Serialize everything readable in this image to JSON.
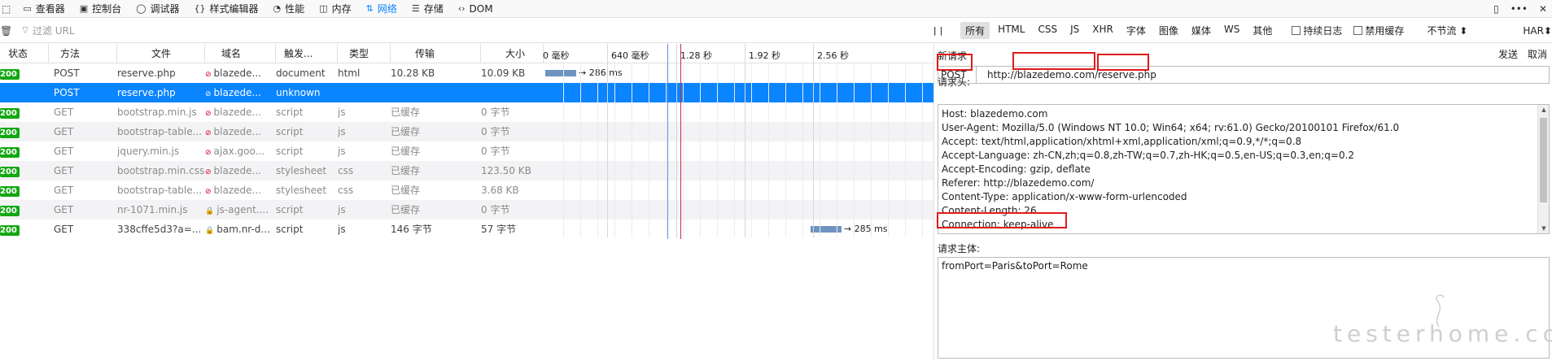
{
  "toolbar": {
    "tabs": [
      {
        "label": "查看器",
        "icon": "inspector-icon"
      },
      {
        "label": "控制台",
        "icon": "console-icon"
      },
      {
        "label": "调试器",
        "icon": "debugger-icon"
      },
      {
        "label": "样式编辑器",
        "icon": "style-editor-icon"
      },
      {
        "label": "性能",
        "icon": "performance-icon"
      },
      {
        "label": "内存",
        "icon": "memory-icon"
      },
      {
        "label": "网络",
        "icon": "network-icon"
      },
      {
        "label": "存储",
        "icon": "storage-icon"
      },
      {
        "label": "DOM",
        "icon": "dom-icon"
      }
    ],
    "active_tab": "网络"
  },
  "filter": {
    "placeholder": "过滤 URL",
    "types": [
      "所有",
      "HTML",
      "CSS",
      "JS",
      "XHR",
      "字体",
      "图像",
      "媒体",
      "WS",
      "其他"
    ],
    "active_type": "所有",
    "persist_logs": "持续日志",
    "disable_cache": "禁用缓存",
    "throttle": "不节流",
    "har": "HAR"
  },
  "columns": [
    "状态",
    "方法",
    "文件",
    "域名",
    "触发...",
    "类型",
    "传输",
    "大小"
  ],
  "waterfall": {
    "ticks": [
      "0 毫秒",
      "640 毫秒",
      "1.28 秒",
      "1.92 秒",
      "2.56 秒"
    ]
  },
  "requests": [
    {
      "status": "200",
      "method": "POST",
      "file": "reserve.php",
      "secure": false,
      "domain": "blazede...",
      "cause": "document",
      "type": "html",
      "transferred": "10.28 KB",
      "size": "10.09 KB",
      "timing": "→ 286 ms",
      "bar_start": 0.0,
      "bar_fraction": 0.37
    },
    {
      "status": "200",
      "method": "POST",
      "file": "reserve.php",
      "secure": false,
      "domain": "blazede...",
      "cause": "unknown",
      "type": "",
      "transferred": "",
      "size": "",
      "timing": "",
      "selected": true
    },
    {
      "status": "200",
      "method": "GET",
      "file": "bootstrap.min.js",
      "secure": false,
      "domain": "blazede...",
      "cause": "script",
      "type": "js",
      "transferred": "已缓存",
      "size": "0 字节",
      "timing": ""
    },
    {
      "status": "200",
      "method": "GET",
      "file": "bootstrap-table...",
      "secure": false,
      "domain": "blazede...",
      "cause": "script",
      "type": "js",
      "transferred": "已缓存",
      "size": "0 字节",
      "timing": ""
    },
    {
      "status": "200",
      "method": "GET",
      "file": "jquery.min.js",
      "secure": false,
      "domain": "ajax.goo...",
      "cause": "script",
      "type": "js",
      "transferred": "已缓存",
      "size": "0 字节",
      "timing": ""
    },
    {
      "status": "200",
      "method": "GET",
      "file": "bootstrap.min.css",
      "secure": false,
      "domain": "blazede...",
      "cause": "stylesheet",
      "type": "css",
      "transferred": "已缓存",
      "size": "123.50 KB",
      "timing": ""
    },
    {
      "status": "200",
      "method": "GET",
      "file": "bootstrap-table...",
      "secure": false,
      "domain": "blazede...",
      "cause": "stylesheet",
      "type": "css",
      "transferred": "已缓存",
      "size": "3.68 KB",
      "timing": ""
    },
    {
      "status": "200",
      "method": "GET",
      "file": "nr-1071.min.js",
      "secure": true,
      "domain": "js-agent....",
      "cause": "script",
      "type": "js",
      "transferred": "已缓存",
      "size": "0 字节",
      "timing": ""
    },
    {
      "status": "200",
      "method": "GET",
      "file": "338cffe5d3?a=...",
      "secure": true,
      "domain": "bam.nr-d...",
      "cause": "script",
      "type": "js",
      "transferred": "146 字节",
      "size": "57 字节",
      "timing": "→ 285 ms",
      "bar_start": 2.35,
      "bar_fraction": 0.37
    }
  ],
  "panel": {
    "title": "新请求",
    "send": "发送",
    "cancel": "取消",
    "method": "POST",
    "url": "http://blazedemo.com/reserve.php",
    "headers_label": "请求头:",
    "headers": [
      "Host: blazedemo.com",
      "User-Agent: Mozilla/5.0 (Windows NT 10.0; Win64; x64; rv:61.0) Gecko/20100101 Firefox/61.0",
      "Accept: text/html,application/xhtml+xml,application/xml;q=0.9,*/*;q=0.8",
      "Accept-Language: zh-CN,zh;q=0.8,zh-TW;q=0.7,zh-HK;q=0.5,en-US;q=0.3,en;q=0.2",
      "Accept-Encoding: gzip, deflate",
      "Referer: http://blazedemo.com/",
      "Content-Type: application/x-www-form-urlencoded",
      "Content-Length: 26",
      "Connection: keep-alive"
    ],
    "body_label": "请求主体:",
    "body": "fromPort=Paris&toPort=Rome"
  },
  "watermark": "testerhome.com",
  "colors": {
    "accent": "#0a84ff",
    "status_ok": "#12a812",
    "highlight": "#e01b1b"
  }
}
